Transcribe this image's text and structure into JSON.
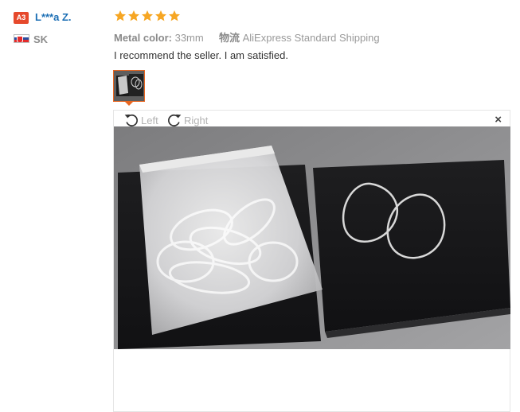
{
  "user": {
    "badge": "A3",
    "name": "L***a Z.",
    "country": "SK"
  },
  "rating": {
    "stars": 5,
    "max": 5,
    "color": "#f6a623"
  },
  "attributes": {
    "metal_color_key": "Metal color:",
    "metal_color_value": "33mm",
    "shipping_key": "物流",
    "shipping_value": "AliExpress Standard Shipping"
  },
  "review_text": "I recommend the seller. I am satisfied.",
  "viewer": {
    "rotate_left_label": "Left",
    "rotate_right_label": "Right",
    "close_label": "×"
  },
  "colors": {
    "badge": "#e6492c",
    "username": "#1c6fb5",
    "thumb_border": "#e8651f"
  }
}
